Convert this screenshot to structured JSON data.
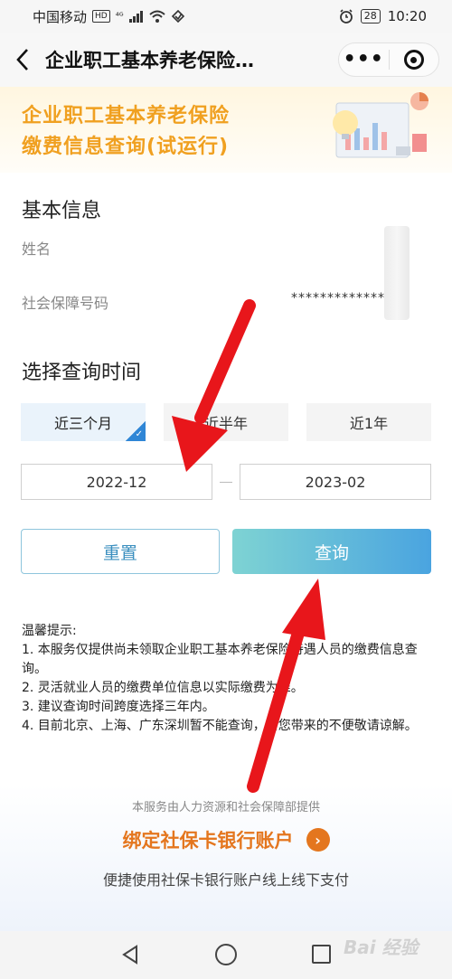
{
  "status_bar": {
    "carrier": "中国移动",
    "hd": "HD",
    "network": "⁴ᴳ",
    "battery": "28",
    "time": "10:20"
  },
  "nav": {
    "title": "企业职工基本养老保险…",
    "more_label": "•••"
  },
  "banner": {
    "line1": "企业职工基本养老保险",
    "line2": "缴费信息查询(试运行)"
  },
  "basic_info": {
    "title": "基本信息",
    "name_label": "姓名",
    "ssn_label": "社会保障号码",
    "ssn_value": "*************"
  },
  "query_time": {
    "title": "选择查询时间",
    "periods": [
      "近三个月",
      "近半年",
      "近1年"
    ],
    "start_date": "2022-12",
    "end_date": "2023-02"
  },
  "buttons": {
    "reset": "重置",
    "query": "查询"
  },
  "tips": {
    "title": "温馨提示:",
    "items": [
      "1. 本服务仅提供尚未领取企业职工基本养老保险待遇人员的缴费信息查询。",
      "2. 灵活就业人员的缴费单位信息以实际缴费为准。",
      "3. 建议查询时间跨度选择三年内。",
      "4. 目前北京、上海、广东深圳暂不能查询，给您带来的不便敬请谅解。"
    ]
  },
  "footer": {
    "provider": "本服务由人力资源和社会保障部提供",
    "bind_label": "绑定社保卡银行账户",
    "bind_sub": "便捷使用社保卡银行账户线上线下支付"
  },
  "watermark": "Bai 经验",
  "colors": {
    "banner_title": "#f0a020",
    "accent_blue": "#2f86d6",
    "bind_orange": "#e4761e",
    "arrow_red": "#e8161b"
  }
}
